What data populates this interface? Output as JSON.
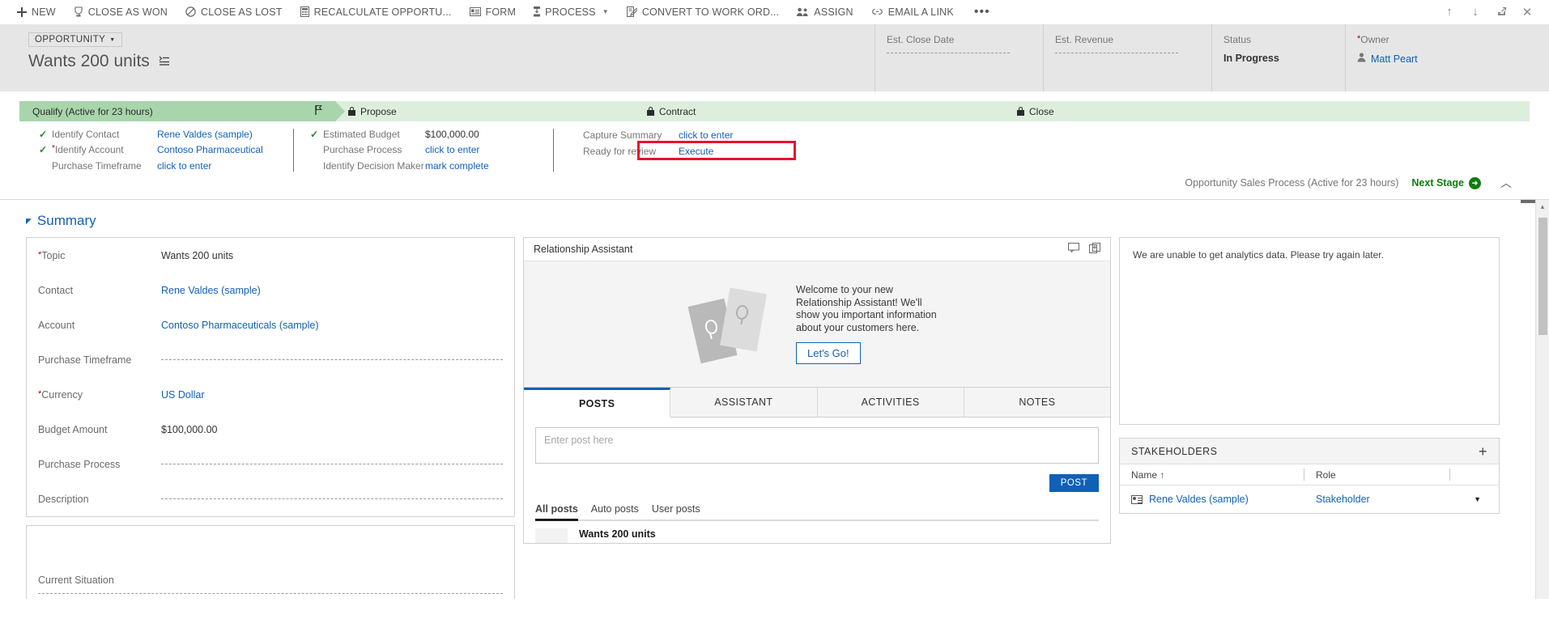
{
  "commandbar": {
    "items": [
      {
        "label": "NEW",
        "icon": "plus-icon",
        "glyph": "+",
        "caret": false
      },
      {
        "label": "CLOSE AS WON",
        "icon": "trophy-icon",
        "glyph": "♁",
        "caret": false
      },
      {
        "label": "CLOSE AS LOST",
        "icon": "no-entry-icon",
        "glyph": "⊘",
        "caret": false
      },
      {
        "label": "RECALCULATE OPPORTU...",
        "icon": "calculator-icon",
        "glyph": "▦",
        "caret": false
      },
      {
        "label": "FORM",
        "icon": "form-icon",
        "glyph": "▤",
        "caret": false
      },
      {
        "label": "PROCESS",
        "icon": "process-icon",
        "glyph": "↕",
        "caret": true
      },
      {
        "label": "CONVERT TO WORK ORD...",
        "icon": "convert-icon",
        "glyph": "✎",
        "caret": false
      },
      {
        "label": "ASSIGN",
        "icon": "assign-people-icon",
        "glyph": "&#128101;",
        "caret": false
      },
      {
        "label": "EMAIL A LINK",
        "icon": "link-icon",
        "glyph": "⚭",
        "caret": false
      }
    ],
    "overflow_label": "•••",
    "right_icons": [
      {
        "name": "up-arrow-icon",
        "glyph": "↑"
      },
      {
        "name": "down-arrow-icon",
        "glyph": "↓"
      },
      {
        "name": "popout-icon",
        "glyph": "⬚"
      },
      {
        "name": "close-icon",
        "glyph": "✕"
      }
    ]
  },
  "record_header": {
    "entity_chip": "OPPORTUNITY",
    "title": "Wants 200 units",
    "fields": [
      {
        "label": "Est. Close Date",
        "value": "",
        "required": false,
        "dashes": true
      },
      {
        "label": "Est. Revenue",
        "value": "",
        "required": false,
        "dashes": true
      },
      {
        "label": "Status",
        "value": "In Progress",
        "required": false,
        "dashes": false
      },
      {
        "label": "Owner",
        "value": "Matt Peart",
        "required": true,
        "dashes": false,
        "is_link": true
      }
    ]
  },
  "process": {
    "stages": [
      {
        "label": "Qualify (Active for 23 hours)",
        "state": "active",
        "locked": false
      },
      {
        "label": "Propose",
        "state": "locked",
        "locked": true
      },
      {
        "label": "Contract",
        "state": "locked",
        "locked": true
      },
      {
        "label": "Close",
        "state": "locked",
        "locked": true
      }
    ],
    "step_groups": [
      {
        "steps": [
          {
            "done": true,
            "required": false,
            "name": "Identify Contact",
            "value": "Rene Valdes (sample)",
            "link": true
          },
          {
            "done": true,
            "required": true,
            "name": "Identify Account",
            "value": "Contoso Pharmaceutical",
            "link": true
          },
          {
            "done": false,
            "required": false,
            "name": "Purchase Timeframe",
            "value": "click to enter",
            "link": true
          }
        ]
      },
      {
        "steps": [
          {
            "done": true,
            "required": false,
            "name": "Estimated Budget",
            "value": "$100,000.00",
            "link": false
          },
          {
            "done": false,
            "required": false,
            "name": "Purchase Process",
            "value": "click to enter",
            "link": true
          },
          {
            "done": false,
            "required": false,
            "name": "Identify Decision Maker",
            "value": "mark complete",
            "link": true
          }
        ]
      },
      {
        "steps": [
          {
            "done": false,
            "required": false,
            "name": "Capture Summary",
            "value": "click to enter",
            "link": true
          },
          {
            "done": false,
            "required": false,
            "name": "Ready for review",
            "value": "Execute",
            "link": true,
            "highlighted": true
          }
        ]
      }
    ],
    "footer": {
      "process_name": "Opportunity Sales Process (Active for 23 hours)",
      "next_stage_label": "Next Stage",
      "collapse_icon": "chevron-up-icon"
    }
  },
  "summary": {
    "section_title": "Summary",
    "fields": [
      {
        "label": "Topic",
        "required": true,
        "value": "Wants 200 units",
        "link": false,
        "empty": false
      },
      {
        "label": "Contact",
        "required": false,
        "value": "Rene Valdes (sample)",
        "link": true,
        "empty": false
      },
      {
        "label": "Account",
        "required": false,
        "value": "Contoso Pharmaceuticals (sample)",
        "link": true,
        "empty": false
      },
      {
        "label": "Purchase Timeframe",
        "required": false,
        "value": "",
        "link": false,
        "empty": true
      },
      {
        "label": "Currency",
        "required": true,
        "value": "US Dollar",
        "link": true,
        "empty": false
      },
      {
        "label": "Budget Amount",
        "required": false,
        "value": "$100,000.00",
        "link": false,
        "empty": false
      },
      {
        "label": "Purchase Process",
        "required": false,
        "value": "",
        "link": false,
        "empty": true
      },
      {
        "label": "Description",
        "required": false,
        "value": "",
        "link": false,
        "empty": true
      }
    ],
    "current_situation_label": "Current Situation"
  },
  "relationship_assistant": {
    "title": "Relationship Assistant",
    "welcome_text": "Welcome to your new Relationship Assistant! We'll show you important information about your customers here.",
    "cta_label": "Let's Go!",
    "tools": [
      {
        "name": "feedback-icon",
        "glyph": "⬜"
      },
      {
        "name": "popout-card-icon",
        "glyph": "⧉"
      }
    ]
  },
  "social_pane": {
    "tabs": [
      {
        "label": "POSTS",
        "active": true
      },
      {
        "label": "ASSISTANT",
        "active": false
      },
      {
        "label": "ACTIVITIES",
        "active": false
      },
      {
        "label": "NOTES",
        "active": false
      }
    ],
    "post_placeholder": "Enter post here",
    "post_button": "POST",
    "filters": [
      {
        "label": "All posts",
        "active": true
      },
      {
        "label": "Auto posts",
        "active": false
      },
      {
        "label": "User posts",
        "active": false
      }
    ],
    "first_post_title": "Wants 200 units"
  },
  "analytics": {
    "message": "We are unable to get analytics data. Please try again later."
  },
  "stakeholders": {
    "title": "STAKEHOLDERS",
    "add_icon": "plus-icon",
    "columns": [
      "Name ↑",
      "Role",
      ""
    ],
    "rows": [
      {
        "name": "Rene Valdes (sample)",
        "role": "Stakeholder"
      }
    ]
  },
  "colors": {
    "accent_blue": "#1160b7",
    "stage_active": "#a8d5ab",
    "stage_locked": "#ddeedd",
    "highlight_red": "#e8112d",
    "next_stage_green": "#107c10"
  }
}
